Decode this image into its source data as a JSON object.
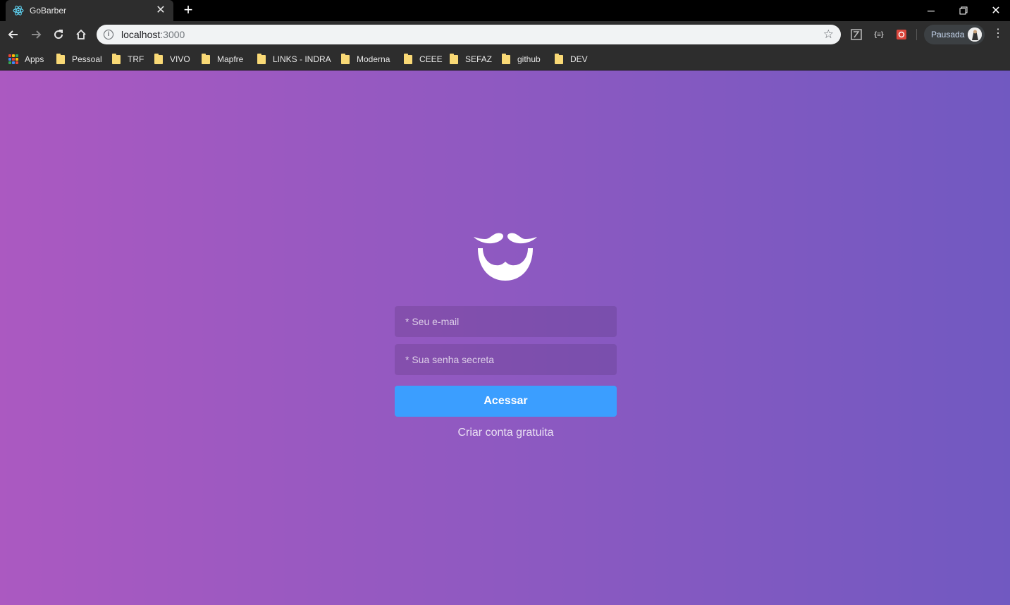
{
  "browser": {
    "tab": {
      "title": "GoBarber",
      "favicon": "react-icon"
    },
    "url": {
      "host": "localhost",
      "port": ":3000"
    },
    "profile": {
      "label": "Pausada"
    },
    "extensions": [
      "image-extension-icon",
      "json-extension-icon",
      "screenshot-extension-icon"
    ]
  },
  "bookmarks": {
    "apps": "Apps",
    "items": [
      "Pessoal",
      "TRF",
      "VIVO",
      "Mapfre",
      "LINKS - INDRA",
      "Moderna",
      "CEEE",
      "SEFAZ",
      "github",
      "DEV"
    ]
  },
  "login": {
    "logo": "gobarber-mustache-logo",
    "email_placeholder": "* Seu e-mail",
    "password_placeholder": "* Sua senha secreta",
    "submit_label": "Acessar",
    "create_account_label": "Criar conta gratuita"
  },
  "colors": {
    "gradient_start": "#ab59c1",
    "gradient_end": "#7159c1",
    "button": "#3b9eff"
  }
}
